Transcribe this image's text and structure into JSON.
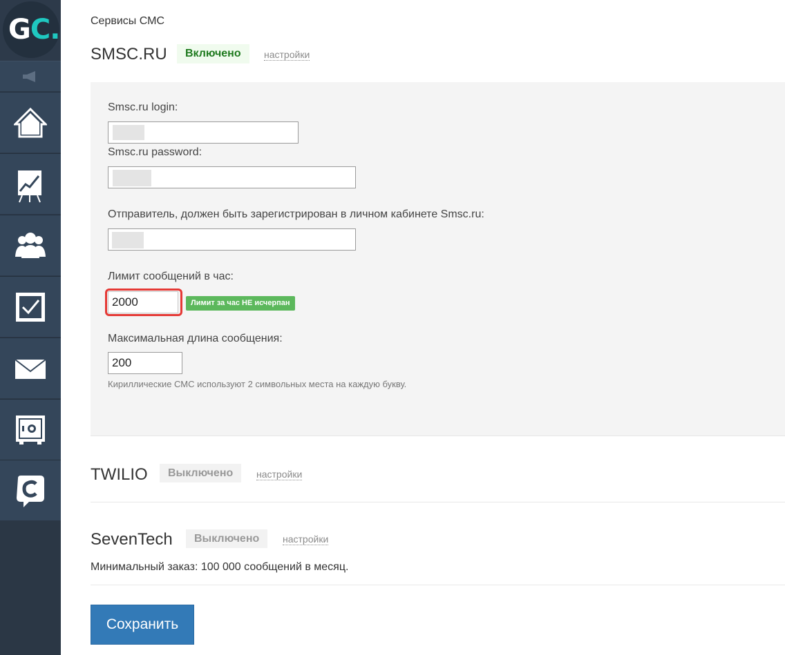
{
  "logo": {
    "g": "G",
    "c": "C",
    "dot": "."
  },
  "sidebar": {
    "items": [
      {
        "icon": "home-icon"
      },
      {
        "icon": "chart-board-icon"
      },
      {
        "icon": "users-icon"
      },
      {
        "icon": "checkbox-icon"
      },
      {
        "icon": "mail-icon"
      },
      {
        "icon": "safe-icon"
      },
      {
        "icon": "chat-icon"
      }
    ]
  },
  "breadcrumb": "Сервисы СМС",
  "providers": {
    "smsc": {
      "title": "SMSC.RU",
      "status": "Включено",
      "settings": "настройки",
      "fields": {
        "login_label": "Smsc.ru login:",
        "password_label": "Smsc.ru password:",
        "sender_label": "Отправитель, должен быть зарегистрирован в личном кабинете Smsc.ru:",
        "limit_label": "Лимит сообщений в час:",
        "limit_value": "2000",
        "limit_badge": "Лимит за час НЕ исчерпан",
        "maxlen_label": "Максимальная длина сообщения:",
        "maxlen_value": "200",
        "hint": "Кириллические СМС используют 2 символьных места на каждую букву."
      }
    },
    "twilio": {
      "title": "TWILIO",
      "status": "Выключено",
      "settings": "настройки"
    },
    "seventech": {
      "title": "SevenTech",
      "status": "Выключено",
      "settings": "настройки",
      "note": "Минимальный заказ: 100 000 сообщений в месяц."
    }
  },
  "save_label": "Сохранить",
  "colors": {
    "sidebar": "#2d3a4a",
    "accent": "#1fc8c0",
    "save": "#337ab7",
    "badge": "#5cb85c",
    "highlight": "#e53935"
  }
}
